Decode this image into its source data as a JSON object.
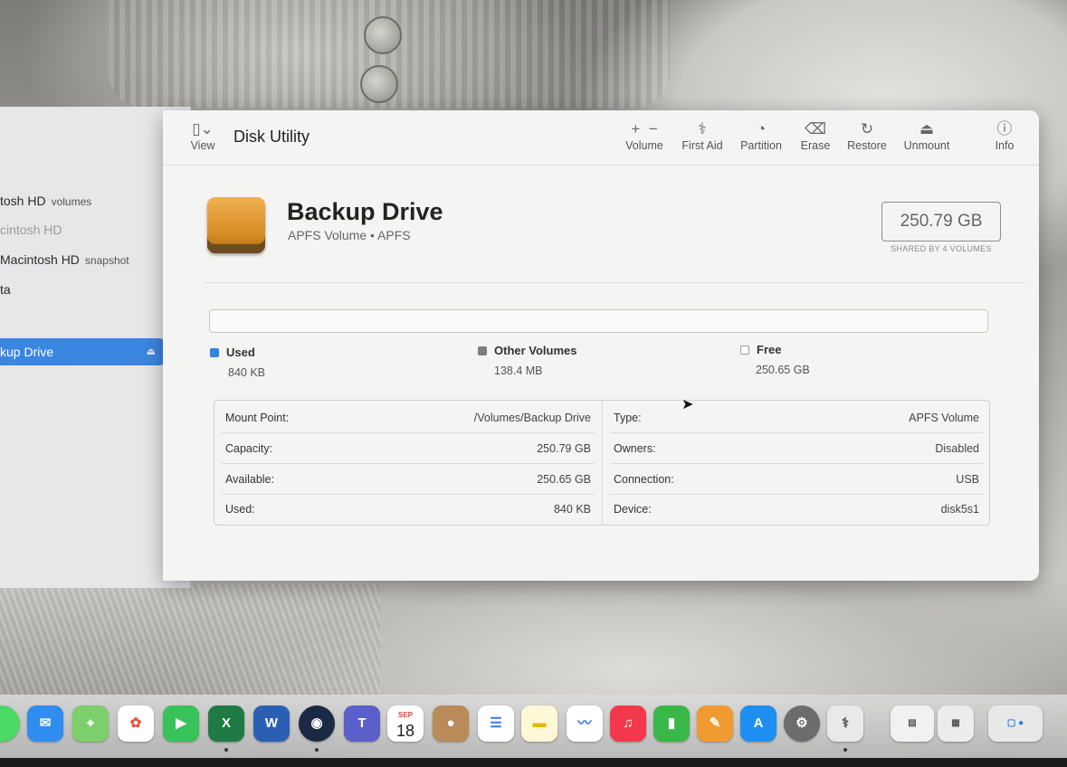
{
  "sidebar": {
    "items": [
      {
        "label": "tosh HD",
        "note": "volumes"
      },
      {
        "label": "cintosh HD",
        "note": ""
      },
      {
        "label": "Macintosh HD",
        "note": "snapshot"
      },
      {
        "label": "ta",
        "note": ""
      },
      {
        "label": "kup Drive",
        "note": ""
      }
    ]
  },
  "toolbar": {
    "view_label": "View",
    "title": "Disk Utility",
    "volume_label": "Volume",
    "first_aid_label": "First Aid",
    "partition_label": "Partition",
    "erase_label": "Erase",
    "restore_label": "Restore",
    "unmount_label": "Unmount",
    "info_label": "Info"
  },
  "drive": {
    "name": "Backup Drive",
    "subtitle": "APFS Volume • APFS",
    "capacity": "250.79 GB",
    "shared_note": "SHARED BY 4 VOLUMES"
  },
  "usage": {
    "used_fraction": 3.3e-06,
    "legend": [
      {
        "label": "Used",
        "value": "840 KB",
        "color": "#2f86db"
      },
      {
        "label": "Other Volumes",
        "value": "138.4 MB",
        "color": "#7d7d7d"
      },
      {
        "label": "Free",
        "value": "250.65 GB",
        "color": "#ffffff"
      }
    ]
  },
  "info": {
    "left": [
      {
        "key": "Mount Point:",
        "value": "/Volumes/Backup Drive"
      },
      {
        "key": "Capacity:",
        "value": "250.79 GB"
      },
      {
        "key": "Available:",
        "value": "250.65 GB"
      },
      {
        "key": "Used:",
        "value": "840 KB"
      }
    ],
    "right": [
      {
        "key": "Type:",
        "value": "APFS Volume"
      },
      {
        "key": "Owners:",
        "value": "Disabled"
      },
      {
        "key": "Connection:",
        "value": "USB"
      },
      {
        "key": "Device:",
        "value": "disk5s1"
      }
    ]
  },
  "dock": {
    "calendar_month": "SEP",
    "calendar_day": "18",
    "excel_letter": "X",
    "word_letter": "W",
    "teams_letter": "T",
    "apps": [
      "messages-icon",
      "mail-icon",
      "maps-icon",
      "photos-icon",
      "facetime-icon",
      "excel-icon",
      "word-icon",
      "steam-icon",
      "teams-icon",
      "calendar-icon",
      "contacts-icon",
      "reminders-icon",
      "notes-icon",
      "freeform-icon",
      "music-icon",
      "numbers-icon",
      "pages-icon",
      "app-store-icon",
      "system-settings-icon",
      "disk-utility-icon",
      "preview-icon",
      "preview-icon-2",
      "downloads-icon"
    ]
  }
}
